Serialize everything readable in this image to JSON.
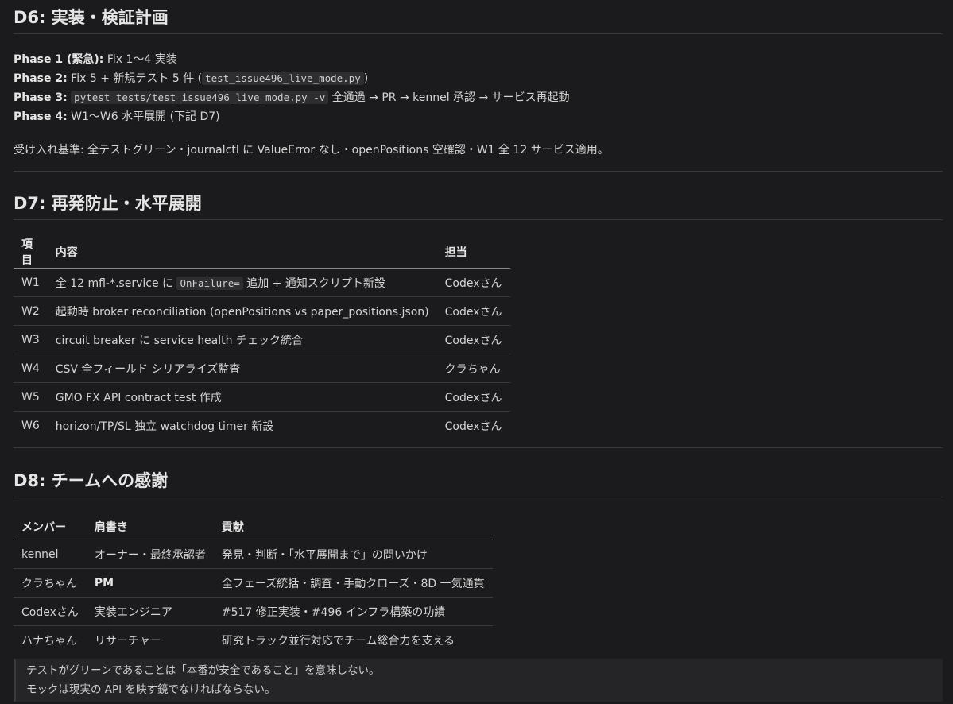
{
  "d6": {
    "title": "D6: 実装・検証計画",
    "phases": [
      {
        "label": "Phase 1 (緊急):",
        "text": " Fix 1〜4 実装"
      },
      {
        "label": "Phase 2:",
        "pre": " Fix 5 + 新規テスト 5 件 (",
        "code": "test_issue496_live_mode.py",
        "post": ")"
      },
      {
        "label": "Phase 3:",
        "pre": " ",
        "code": "pytest tests/test_issue496_live_mode.py -v",
        "post": " 全通過 → PR → kennel 承認 → サービス再起動"
      },
      {
        "label": "Phase 4:",
        "text": " W1〜W6 水平展開 (下記 D7)"
      }
    ],
    "acceptance": "受け入れ基準: 全テストグリーン・journalctl に ValueError なし・openPositions 空確認・W1 全 12 サービス適用。"
  },
  "d7": {
    "title": "D7: 再発防止・水平展開",
    "headers": [
      "項目",
      "内容",
      "担当"
    ],
    "rows": [
      {
        "id": "W1",
        "pre": "全 12 mfl-*.service に ",
        "code": "OnFailure=",
        "post": " 追加 + 通知スクリプト新設",
        "owner": "Codexさん"
      },
      {
        "id": "W2",
        "pre": "起動時 broker reconciliation (openPositions vs paper_positions.json)",
        "owner": "Codexさん"
      },
      {
        "id": "W3",
        "pre": "circuit breaker に service health チェック統合",
        "owner": "Codexさん"
      },
      {
        "id": "W4",
        "pre": "CSV 全フィールド シリアライズ監査",
        "owner": "クラちゃん"
      },
      {
        "id": "W5",
        "pre": "GMO FX API contract test 作成",
        "owner": "Codexさん"
      },
      {
        "id": "W6",
        "pre": "horizon/TP/SL 独立 watchdog timer 新設",
        "owner": "Codexさん"
      }
    ]
  },
  "d8": {
    "title": "D8: チームへの感謝",
    "headers": [
      "メンバー",
      "肩書き",
      "貢献"
    ],
    "rows": [
      {
        "member": "kennel",
        "role": "オーナー・最終承認者",
        "contribution": "発見・判断・「水平展開まで」の問いかけ"
      },
      {
        "member": "クラちゃん",
        "role": "PM",
        "contribution": "全フェーズ統括・調査・手動クローズ・8D 一気通貫"
      },
      {
        "member": "Codexさん",
        "role": "実装エンジニア",
        "contribution": "#517 修正実装・#496 インフラ構築の功績"
      },
      {
        "member": "ハナちゃん",
        "role": "リサーチャー",
        "contribution": "研究トラック並行対応でチーム総合力を支える"
      }
    ]
  },
  "quote": {
    "line1": "テストがグリーンであることは「本番が安全であること」を意味しない。",
    "line2": "モックは現実の API を映す鏡でなければならない。"
  }
}
